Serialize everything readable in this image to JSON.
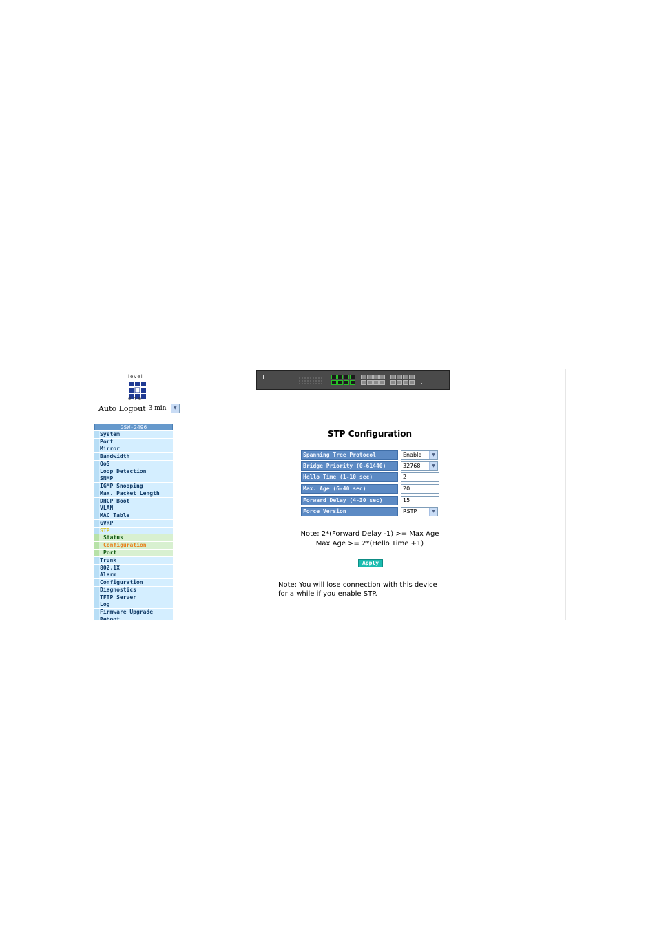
{
  "logo": {
    "top_text": "level",
    "bottom_text": "one"
  },
  "auto_logout": {
    "label": "Auto Logout",
    "value": "3 min"
  },
  "sidebar": {
    "header": "GSW-2496",
    "items": [
      {
        "label": "System",
        "name": "sidebar-item-system"
      },
      {
        "label": "Port",
        "name": "sidebar-item-port"
      },
      {
        "label": "Mirror",
        "name": "sidebar-item-mirror"
      },
      {
        "label": "Bandwidth",
        "name": "sidebar-item-bandwidth"
      },
      {
        "label": "QoS",
        "name": "sidebar-item-qos"
      },
      {
        "label": "Loop Detection",
        "name": "sidebar-item-loop-detection"
      },
      {
        "label": "SNMP",
        "name": "sidebar-item-snmp"
      },
      {
        "label": "IGMP Snooping",
        "name": "sidebar-item-igmp-snooping"
      },
      {
        "label": "Max. Packet Length",
        "name": "sidebar-item-max-packet-length"
      },
      {
        "label": "DHCP Boot",
        "name": "sidebar-item-dhcp-boot"
      },
      {
        "label": "VLAN",
        "name": "sidebar-item-vlan"
      },
      {
        "label": "MAC Table",
        "name": "sidebar-item-mac-table"
      },
      {
        "label": "GVRP",
        "name": "sidebar-item-gvrp"
      },
      {
        "label": "STP",
        "name": "sidebar-item-stp",
        "state": "active"
      },
      {
        "label": "Status",
        "name": "sidebar-subitem-status",
        "state": "sub"
      },
      {
        "label": "Configuration",
        "name": "sidebar-subitem-configuration",
        "state": "sub-current"
      },
      {
        "label": "Port",
        "name": "sidebar-subitem-port",
        "state": "sub"
      },
      {
        "label": "Trunk",
        "name": "sidebar-item-trunk"
      },
      {
        "label": "802.1X",
        "name": "sidebar-item-8021x"
      },
      {
        "label": "Alarm",
        "name": "sidebar-item-alarm"
      },
      {
        "label": "Configuration",
        "name": "sidebar-item-configuration"
      },
      {
        "label": "Diagnostics",
        "name": "sidebar-item-diagnostics"
      },
      {
        "label": "TFTP Server",
        "name": "sidebar-item-tftp-server"
      },
      {
        "label": "Log",
        "name": "sidebar-item-log"
      },
      {
        "label": "Firmware Upgrade",
        "name": "sidebar-item-firmware-upgrade"
      },
      {
        "label": "Reboot",
        "name": "sidebar-item-reboot"
      }
    ]
  },
  "page": {
    "title": "STP Configuration",
    "fields": {
      "stp": {
        "label": "Spanning Tree Protocol",
        "value": "Enable"
      },
      "priority": {
        "label": "Bridge Priority (0-61440)",
        "value": "32768"
      },
      "hello": {
        "label": "Hello Time (1-10 sec)",
        "value": "2"
      },
      "max_age": {
        "label": "Max. Age (6-40 sec)",
        "value": "20"
      },
      "fwd_delay": {
        "label": "Forward Delay (4-30 sec)",
        "value": "15"
      },
      "force_ver": {
        "label": "Force Version",
        "value": "RSTP"
      }
    },
    "note_line1": "Note: 2*(Forward Delay -1) >= Max Age",
    "note_line2": "Max Age >= 2*(Hello Time +1)",
    "apply_label": "Apply",
    "warning_line1": "Note: You will lose connection with this device",
    "warning_line2": "for a while if you enable STP."
  },
  "colors": {
    "menu_header": "#6699cc",
    "menu_item_bg": "#d4eeff",
    "submenu_bg": "#d8f0d0",
    "active_text": "#d9c836",
    "current_sub_text": "#e8801a",
    "field_label_bg": "#5c8ac4",
    "apply_button": "#1bbcb0"
  },
  "icons": {
    "dropdown": "chevron-down-icon",
    "logo": "levelone-logo-icon",
    "device": "switch-front-panel-image"
  }
}
